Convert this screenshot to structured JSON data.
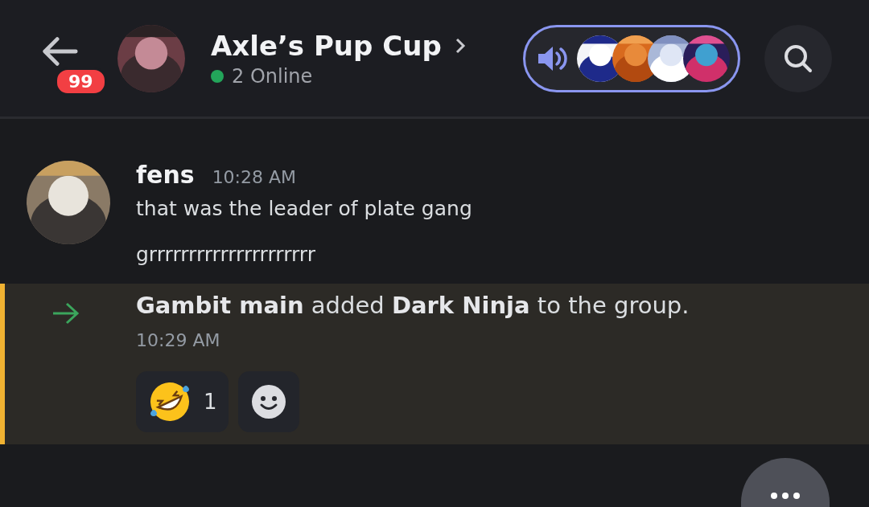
{
  "header": {
    "unread_badge": "99",
    "title": "Axle’s Pup Cup",
    "status": {
      "online": true,
      "text": "2 Online"
    },
    "voice": {
      "active": true
    }
  },
  "messages": [
    {
      "kind": "message",
      "author": "fens",
      "time": "10:28 AM",
      "lines": [
        "that was the leader of plate gang",
        "grrrrrrrrrrrrrrrrrrrrr"
      ]
    },
    {
      "kind": "system",
      "highlighted": true,
      "text": "**Gambit main** added **Dark Ninja** to the group.",
      "time": "10:29 AM",
      "reactions": [
        {
          "count": "1",
          "selected": false
        }
      ]
    }
  ]
}
